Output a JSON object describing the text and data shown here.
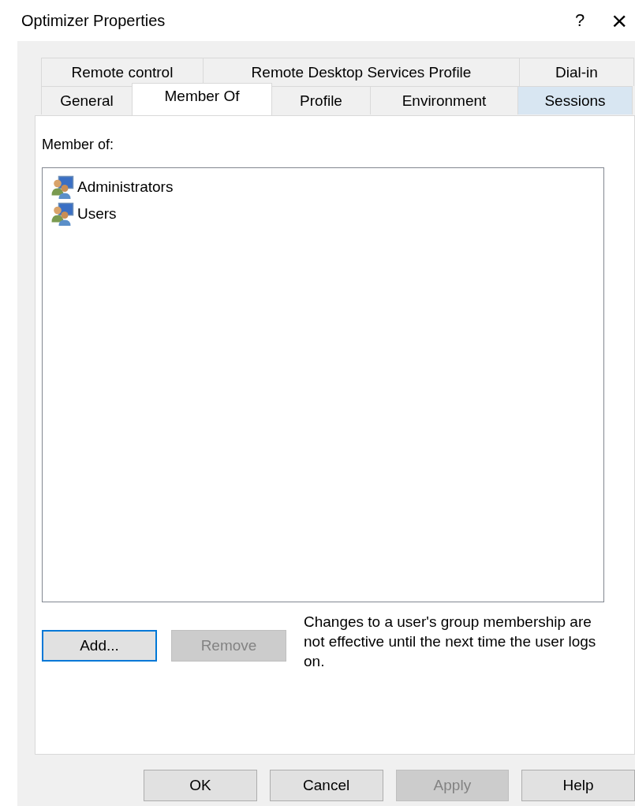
{
  "window": {
    "title": "Optimizer Properties",
    "help": "?",
    "close": "×"
  },
  "tab_rows": [
    [
      {
        "label": "Remote control",
        "selected": false,
        "highlighted": false
      },
      {
        "label": "Remote Desktop Services Profile",
        "selected": false,
        "highlighted": false
      },
      {
        "label": "Dial-in",
        "selected": false,
        "highlighted": false
      }
    ],
    [
      {
        "label": "General",
        "selected": false,
        "highlighted": false
      },
      {
        "label": "Member Of",
        "selected": true,
        "highlighted": false
      },
      {
        "label": "Profile",
        "selected": false,
        "highlighted": false
      },
      {
        "label": "Environment",
        "selected": false,
        "highlighted": false
      },
      {
        "label": "Sessions",
        "selected": false,
        "highlighted": true
      }
    ]
  ],
  "member_of": {
    "label": "Member of:",
    "items": [
      {
        "name": "Administrators",
        "selected": false
      },
      {
        "name": "Users",
        "selected": false
      }
    ]
  },
  "list_buttons": [
    {
      "label": "Add...",
      "disabled": false,
      "focused": true
    },
    {
      "label": "Remove",
      "disabled": true,
      "focused": false
    }
  ],
  "note": "Changes to a user's group membership are not effective until the next time the user logs on.",
  "dialog_buttons": [
    {
      "label": "OK",
      "disabled": false
    },
    {
      "label": "Cancel",
      "disabled": false
    },
    {
      "label": "Apply",
      "disabled": true
    },
    {
      "label": "Help",
      "disabled": false
    }
  ]
}
